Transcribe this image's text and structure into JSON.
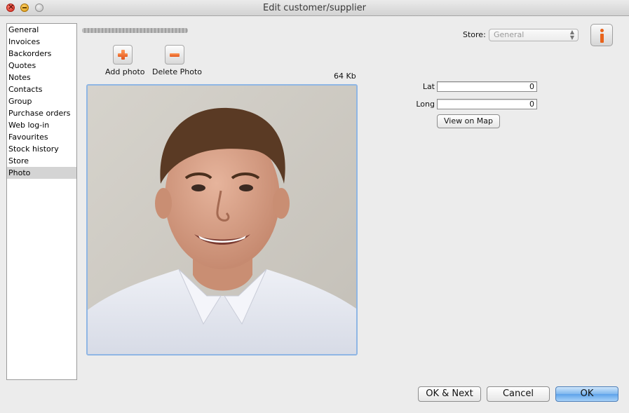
{
  "window": {
    "title": "Edit customer/supplier"
  },
  "sidebar": {
    "items": [
      {
        "label": "General"
      },
      {
        "label": "Invoices"
      },
      {
        "label": "Backorders"
      },
      {
        "label": "Quotes"
      },
      {
        "label": "Notes"
      },
      {
        "label": "Contacts"
      },
      {
        "label": "Group"
      },
      {
        "label": "Purchase orders"
      },
      {
        "label": "Web log-in"
      },
      {
        "label": "Favourites"
      },
      {
        "label": "Stock history"
      },
      {
        "label": "Store"
      },
      {
        "label": "Photo"
      }
    ],
    "selected": "Photo"
  },
  "photo_panel": {
    "add_label": "Add photo",
    "delete_label": "Delete Photo",
    "file_size": "64 Kb"
  },
  "store": {
    "label": "Store:",
    "value": "General"
  },
  "location": {
    "lat_label": "Lat",
    "lat_value": "0",
    "long_label": "Long",
    "long_value": "0",
    "map_button": "View on Map"
  },
  "footer": {
    "ok_next": "OK & Next",
    "cancel": "Cancel",
    "ok": "OK"
  },
  "colors": {
    "accent_orange": "#e8631c",
    "default_button_blue": "#5ea3ea",
    "selection_grey": "#d4d4d4"
  },
  "icons": [
    "close-icon",
    "minimize-icon",
    "zoom-icon",
    "plus-icon",
    "minus-icon",
    "info-icon"
  ]
}
